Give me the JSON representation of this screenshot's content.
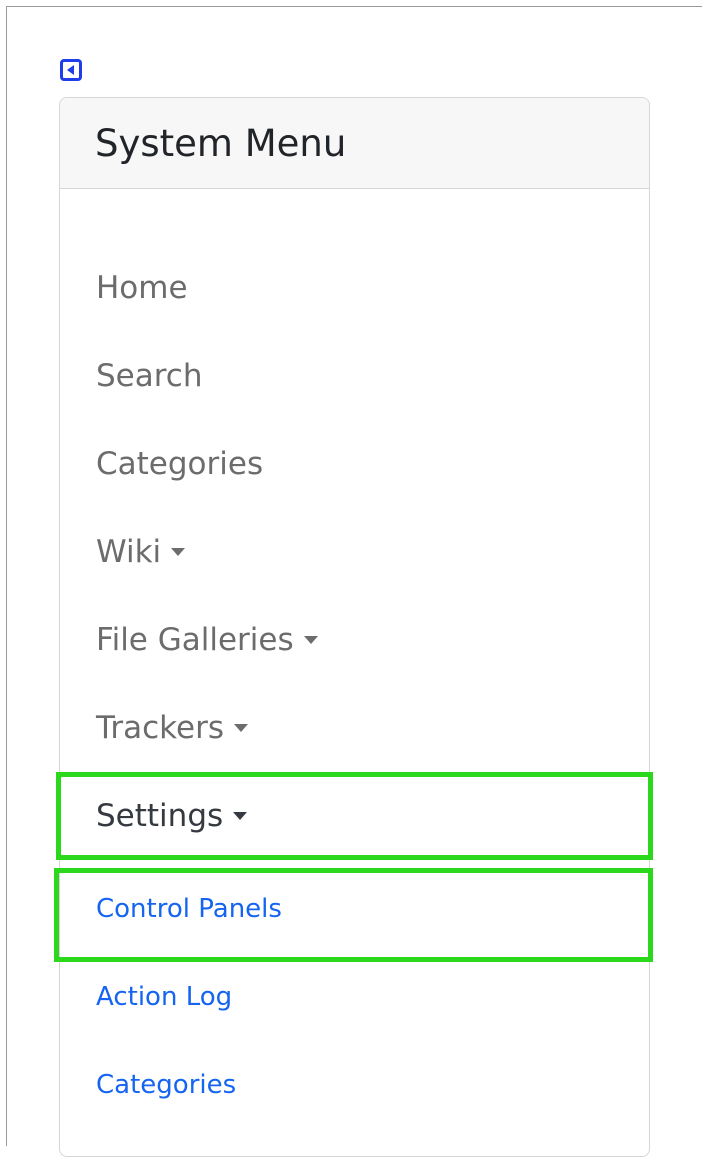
{
  "sidebar": {
    "toggle_icon": "collapse-left-icon",
    "accent_color": "#1f3de8",
    "title": "System Menu",
    "items": [
      {
        "label": "Home",
        "has_caret": false
      },
      {
        "label": "Search",
        "has_caret": false
      },
      {
        "label": "Categories",
        "has_caret": false
      },
      {
        "label": "Wiki",
        "has_caret": true
      },
      {
        "label": "File Galleries",
        "has_caret": true
      },
      {
        "label": "Trackers",
        "has_caret": true
      },
      {
        "label": "Settings",
        "has_caret": true
      }
    ],
    "settings_submenu": [
      {
        "label": "Control Panels"
      },
      {
        "label": "Action Log"
      },
      {
        "label": "Categories"
      }
    ],
    "link_color": "#1565f0",
    "highlight_color": "#2cd81b"
  }
}
